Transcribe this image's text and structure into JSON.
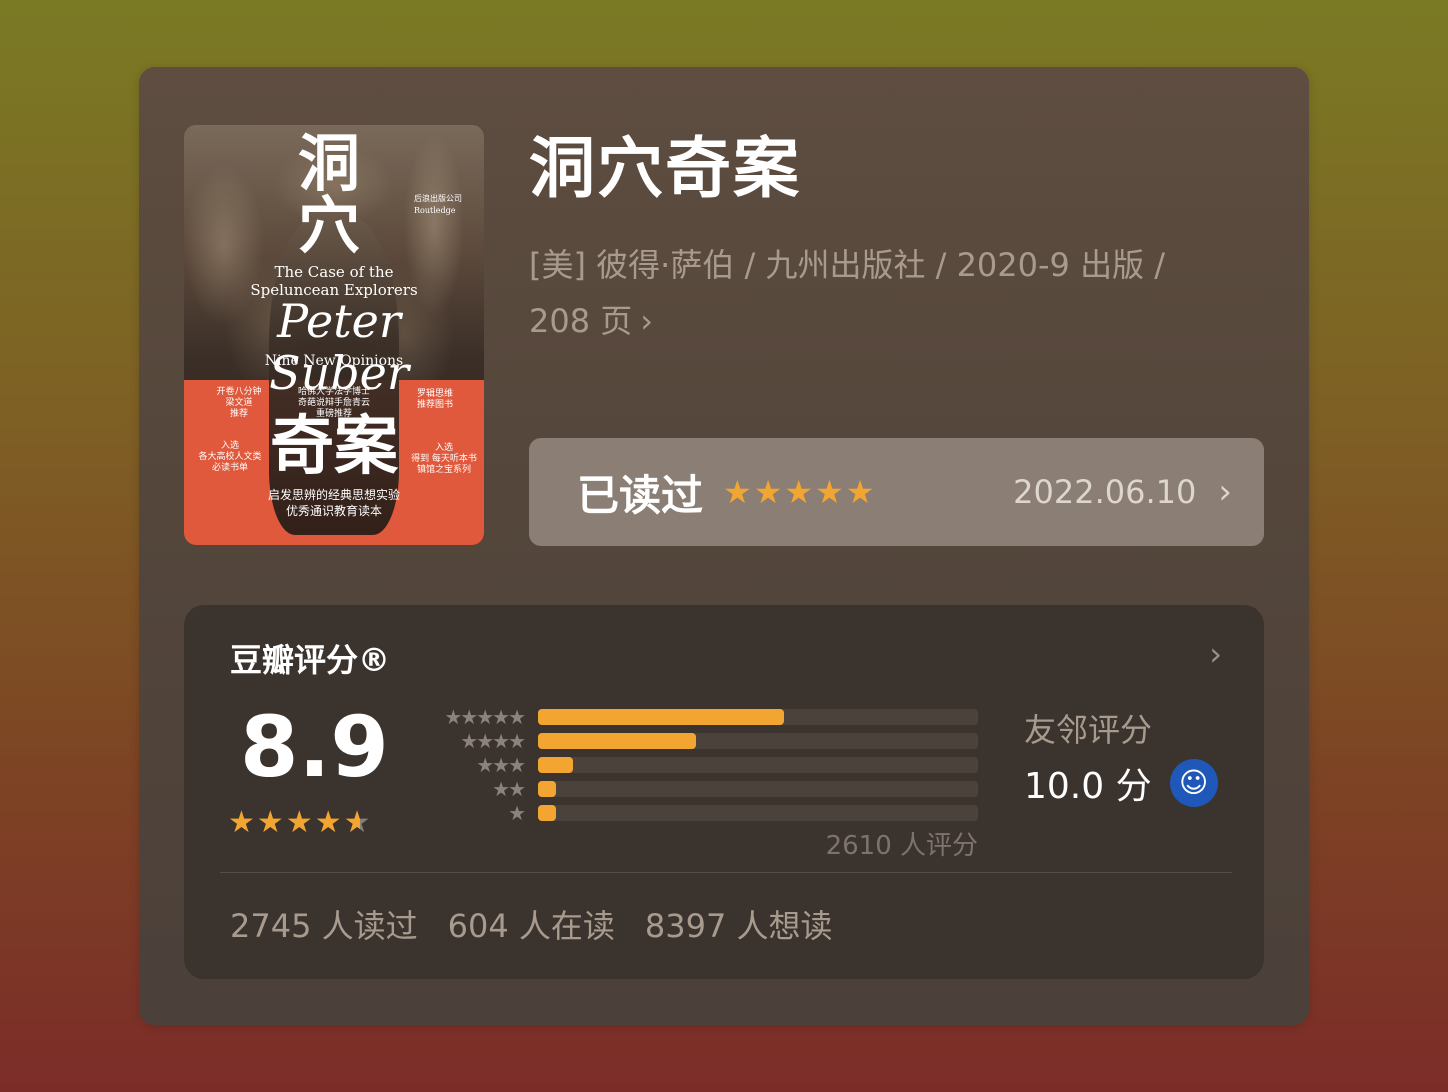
{
  "book": {
    "title": "洞穴奇案",
    "meta_line1": "[美] 彼得·萨伯 / 九州出版社 / 2020-9 出版 /",
    "meta_line2": "208 页",
    "meta_chevron": "›"
  },
  "cover": {
    "char1": "洞",
    "char2": "穴",
    "en_title_1": "The Case of the",
    "en_title_2": "Speluncean Explorers",
    "author": "Peter Suber",
    "subtitle_en": "Nine New Opinions",
    "big_title": "奇案",
    "tagline_1": "启发思辨的经典思想实验",
    "tagline_2": "优秀通识教育读本",
    "blurb_left_1": "开卷八分钟",
    "blurb_left_2": "梁文道",
    "blurb_left_3": "推荐",
    "blurb_mid_1": "哈佛大学法学博士",
    "blurb_mid_2": "奇葩说辩手詹青云",
    "blurb_mid_3": "重磅推荐",
    "blurb_right_1": "罗辑思维",
    "blurb_right_2": "推荐图书",
    "blurb_left_b1": "入选",
    "blurb_left_b2": "各大高校人文类",
    "blurb_left_b3": "必读书单",
    "blurb_right_b1": "入选",
    "blurb_right_b2": "得到 每天听本书",
    "blurb_right_b3": "镇馆之宝系列",
    "publisher_1": "后浪出版公司",
    "publisher_2": "Routledge"
  },
  "status": {
    "label": "已读过",
    "rating_stars": 5,
    "date": "2022.06.10",
    "chevron": "›"
  },
  "rating": {
    "title": "豆瓣评分®",
    "chevron": "›",
    "score": "8.9",
    "score_stars": 4.5,
    "distribution": [
      {
        "stars": "★★★★★",
        "fraction": 0.56
      },
      {
        "stars": "★★★★",
        "fraction": 0.36
      },
      {
        "stars": "★★★",
        "fraction": 0.08
      },
      {
        "stars": "★★",
        "fraction": 0.04
      },
      {
        "stars": "★",
        "fraction": 0.04
      }
    ],
    "count": "2610 人评分",
    "friend_label": "友邻评分",
    "friend_score": "10.0 分",
    "friend_icon": "douban-friends-icon",
    "read": "2745 人读过",
    "reading": "604 人在读",
    "want": "8397 人想读"
  },
  "colors": {
    "accent": "#f3a532",
    "friend_badge": "#1f58b8"
  }
}
